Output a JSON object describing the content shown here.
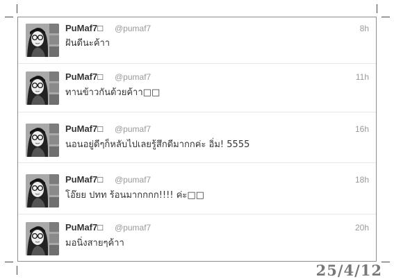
{
  "tweets": [
    {
      "name": "PuMaf7□",
      "handle": "@pumaf7",
      "time": "8h",
      "text": "ฝันดีนะค้าา"
    },
    {
      "name": "PuMaf7□",
      "handle": "@pumaf7",
      "time": "11h",
      "text": "ทานข้าวกันด้วยค้าา□□"
    },
    {
      "name": "PuMaf7□",
      "handle": "@pumaf7",
      "time": "16h",
      "text": "นอนอยู่ดีๆก็หลับไปเลยรู้สึกดีมากกค่ะ อิ่ม! 5555"
    },
    {
      "name": "PuMaf7□",
      "handle": "@pumaf7",
      "time": "18h",
      "text": "โอ๊ยย ปทท ร้อนมากกกก!!!! ค่ะ□□"
    },
    {
      "name": "PuMaf7□",
      "handle": "@pumaf7",
      "time": "20h",
      "text": "มอนิ่งสายๆค้าา"
    }
  ],
  "date_stamp": "25/4/12"
}
